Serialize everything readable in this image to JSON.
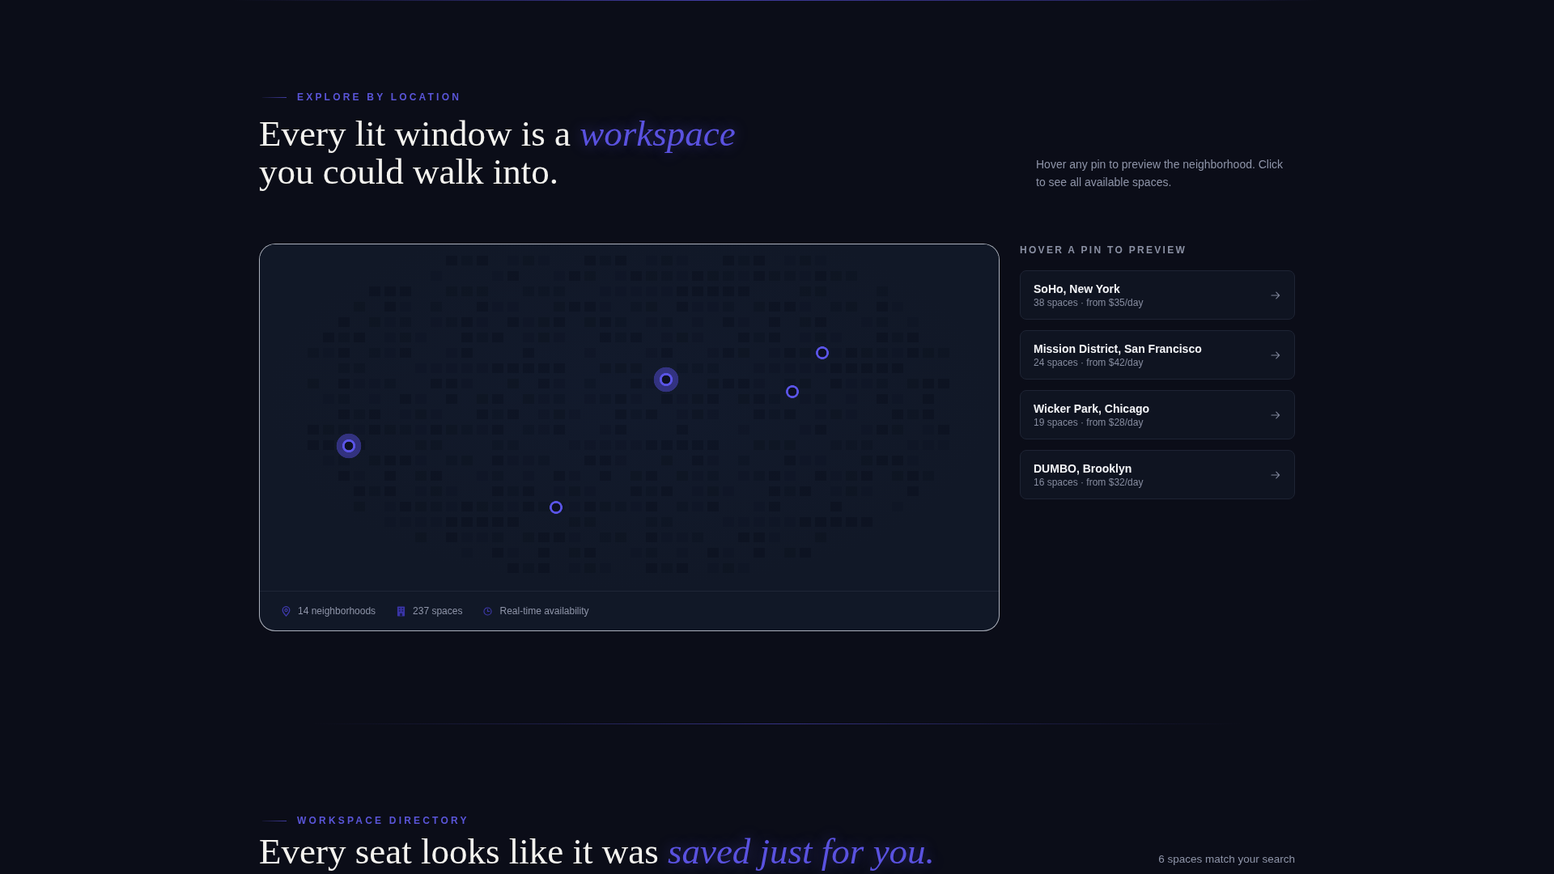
{
  "section": {
    "eyebrow": "EXPLORE BY LOCATION",
    "title": "Every lit window is a *workspace*\nyou could walk into.",
    "description": "Hover any pin to preview the neighborhood. Click to see all available spaces."
  },
  "map": {
    "pins": [
      {
        "highlighted": true
      },
      {
        "highlighted": false
      },
      {
        "highlighted": true
      },
      {
        "highlighted": false
      },
      {
        "highlighted": false
      }
    ],
    "stats": [
      {
        "kind": "pin",
        "label": "14 neighborhoods"
      },
      {
        "kind": "building",
        "label": "237 spaces"
      },
      {
        "kind": "clock",
        "label": "Real-time availability"
      }
    ]
  },
  "preview": {
    "heading": "HOVER A PIN TO PREVIEW",
    "locations": [
      {
        "name": "SoHo, New York",
        "details": "38 spaces · from $35/day"
      },
      {
        "name": "Mission District, San Francisco",
        "details": "24 spaces · from $42/day"
      },
      {
        "name": "Wicker Park, Chicago",
        "details": "19 spaces · from $28/day"
      },
      {
        "name": "DUMBO, Brooklyn",
        "details": "16 spaces · from $32/day"
      }
    ]
  },
  "directory": {
    "eyebrow": "WORKSPACE DIRECTORY",
    "title": "Every seat looks like it was *saved just for you.*",
    "match_count": "6 spaces match your search"
  }
}
